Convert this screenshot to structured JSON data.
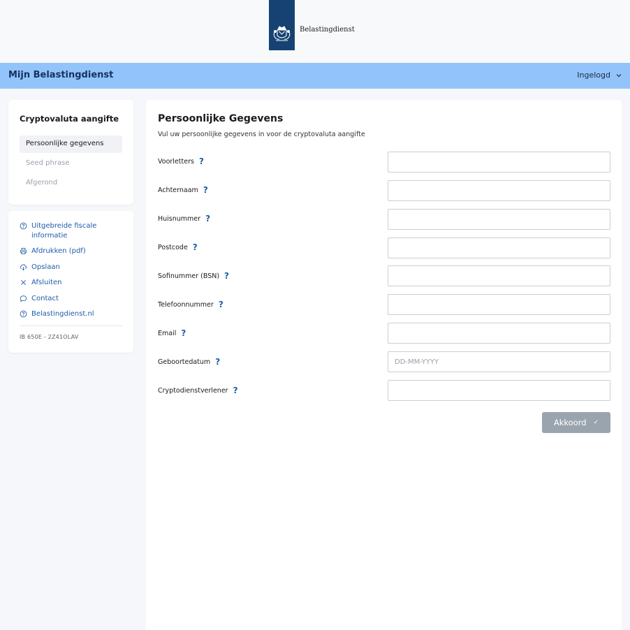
{
  "header": {
    "logo_text": "Belastingdienst"
  },
  "nav": {
    "title": "Mijn Belastingdienst",
    "user_status": "Ingelogd"
  },
  "steps": {
    "title": "Cryptovaluta aangifte",
    "items": [
      {
        "label": "Persoonlijke gegevens",
        "state": "active"
      },
      {
        "label": "Seed phrase",
        "state": "pending"
      },
      {
        "label": "Afgerond",
        "state": "pending"
      }
    ]
  },
  "links": {
    "items": [
      {
        "label": "Uitgebreide fiscale informatie",
        "icon": "question-circle-icon"
      },
      {
        "label": "Afdrukken (pdf)",
        "icon": "printer-icon"
      },
      {
        "label": "Opslaan",
        "icon": "cloud-download-icon"
      },
      {
        "label": "Afsluiten",
        "icon": "close-icon"
      },
      {
        "label": "Contact",
        "icon": "chat-icon"
      },
      {
        "label": "Belastingdienst.nl",
        "icon": "question-circle-icon"
      }
    ],
    "form_code": "IB 650E - 2Z41OLAV"
  },
  "form": {
    "title": "Persoonlijke Gegevens",
    "subtitle": "Vul uw persoonlijke gegevens in voor de cryptovaluta aangifte",
    "help_glyph": "?",
    "fields": [
      {
        "label": "Voorletters",
        "value": "",
        "placeholder": ""
      },
      {
        "label": "Achternaam",
        "value": "",
        "placeholder": ""
      },
      {
        "label": "Huisnummer",
        "value": "",
        "placeholder": ""
      },
      {
        "label": "Postcode",
        "value": "",
        "placeholder": ""
      },
      {
        "label": "Sofinummer (BSN)",
        "value": "",
        "placeholder": ""
      },
      {
        "label": "Telefoonnummer",
        "value": "",
        "placeholder": ""
      },
      {
        "label": "Email",
        "value": "",
        "placeholder": ""
      },
      {
        "label": "Geboortedatum",
        "value": "",
        "placeholder": "DD-MM-YYYY"
      },
      {
        "label": "Cryptodienstverlener",
        "value": "",
        "placeholder": ""
      }
    ],
    "submit_label": "Akkoord",
    "submit_check": "✓"
  },
  "colors": {
    "brand_blue": "#154273",
    "nav_bar": "#93c3fb",
    "link": "#1f5ba8",
    "button_disabled": "#9aa4ae"
  }
}
